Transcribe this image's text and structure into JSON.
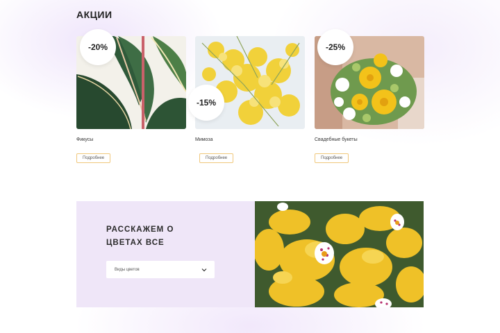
{
  "promotions": {
    "title": "АКЦИИ",
    "cards": [
      {
        "discount": "-20%",
        "name": "Фикусы",
        "more_label": "Подробнее",
        "image_icon": "ficus-leaves-icon"
      },
      {
        "discount": "-15%",
        "name": "Мимоза",
        "more_label": "Подробнее",
        "image_icon": "mimosa-icon"
      },
      {
        "discount": "-25%",
        "name": "Свадебные букеты",
        "more_label": "Подробнее",
        "image_icon": "wedding-bouquet-icon"
      }
    ]
  },
  "about": {
    "title_line1": "РАССКАЖЕМ О",
    "title_line2": "ЦВЕТАХ ВСЕ",
    "select_value": "Виды цветов",
    "image_icon": "orchid-icon"
  },
  "colors": {
    "accent_border": "#f0c77a",
    "panel_bg": "#efe6f8",
    "badge_bg": "#ffffff"
  }
}
